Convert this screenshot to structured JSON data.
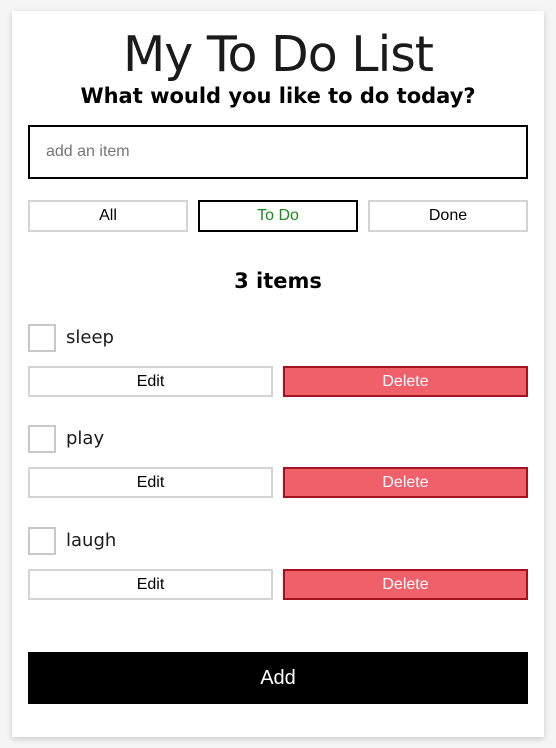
{
  "header": {
    "title": "My To Do List",
    "subtitle": "What would you like to do today?"
  },
  "new_item": {
    "placeholder": "add an item",
    "value": ""
  },
  "filters": [
    {
      "label": "All",
      "active": false
    },
    {
      "label": "To Do",
      "active": true
    },
    {
      "label": "Done",
      "active": false
    }
  ],
  "count_text": "3 items",
  "items": [
    {
      "label": "sleep",
      "checked": false,
      "edit_label": "Edit",
      "delete_label": "Delete"
    },
    {
      "label": "play",
      "checked": false,
      "edit_label": "Edit",
      "delete_label": "Delete"
    },
    {
      "label": "laugh",
      "checked": false,
      "edit_label": "Edit",
      "delete_label": "Delete"
    }
  ],
  "add_button_label": "Add",
  "colors": {
    "active_filter_text": "#1b8a1b",
    "delete_bg": "#f0606a",
    "delete_border": "#a3121f",
    "add_bg": "#000000"
  }
}
